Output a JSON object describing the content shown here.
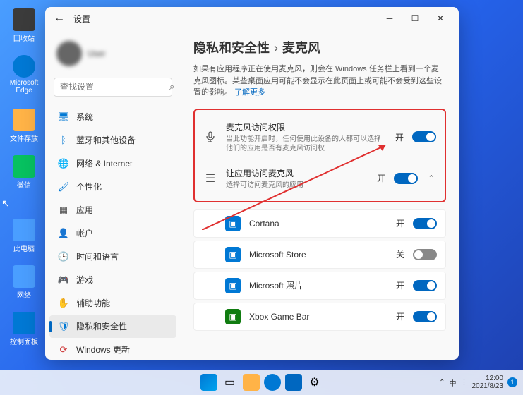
{
  "desktop": {
    "icons": [
      {
        "label": "回收站",
        "color": "#f0f0f0"
      },
      {
        "label": "Microsoft Edge",
        "color": "#0078d4"
      },
      {
        "label": "文件存放",
        "color": "#ffb347"
      },
      {
        "label": "微信",
        "color": "#07c160"
      },
      {
        "label": "此电脑",
        "color": "#4a9eff"
      },
      {
        "label": "网络",
        "color": "#4a9eff"
      },
      {
        "label": "控制面板",
        "color": "#0078d4"
      }
    ]
  },
  "window": {
    "title": "设置",
    "search_placeholder": "查找设置",
    "nav": [
      {
        "icon": "🖥",
        "label": "系统",
        "color": "#0078d4"
      },
      {
        "icon": "ᛒ",
        "label": "蓝牙和其他设备",
        "color": "#0078d4"
      },
      {
        "icon": "🌐",
        "label": "网络 & Internet",
        "color": "#2e7d32"
      },
      {
        "icon": "🖌",
        "label": "个性化",
        "color": "#0078d4"
      },
      {
        "icon": "▦",
        "label": "应用",
        "color": "#555"
      },
      {
        "icon": "👤",
        "label": "帐户",
        "color": "#555"
      },
      {
        "icon": "🕒",
        "label": "时间和语言",
        "color": "#2e7d32"
      },
      {
        "icon": "🎮",
        "label": "游戏",
        "color": "#555"
      },
      {
        "icon": "✋",
        "label": "辅助功能",
        "color": "#0078d4"
      },
      {
        "icon": "🛡",
        "label": "隐私和安全性",
        "color": "#0078d4",
        "selected": true
      },
      {
        "icon": "⟳",
        "label": "Windows 更新",
        "color": "#d04040"
      }
    ]
  },
  "content": {
    "breadcrumb_parent": "隐私和安全性",
    "breadcrumb_current": "麦克风",
    "description": "如果有应用程序正在使用麦克风，则会在 Windows 任务栏上看到一个麦克风图标。某些桌面应用可能不会显示在此页面上或可能不会受到这些设置的影响。",
    "learn_more": "了解更多",
    "mic_access": {
      "title": "麦克风访问权限",
      "sub": "当此功能开启时，任何使用此设备的人都可以选择他们的应用是否有麦克风访问权",
      "state": "开"
    },
    "app_access": {
      "title": "让应用访问麦克风",
      "sub": "选择可访问麦克风的应用",
      "state": "开"
    },
    "apps": [
      {
        "name": "Cortana",
        "state": "开",
        "on": true,
        "color": "#0078d4"
      },
      {
        "name": "Microsoft Store",
        "state": "关",
        "on": false,
        "color": "#0078d4"
      },
      {
        "name": "Microsoft 照片",
        "state": "开",
        "on": true,
        "color": "#0078d4"
      },
      {
        "name": "Xbox Game Bar",
        "state": "开",
        "on": true,
        "color": "#107c10"
      }
    ]
  },
  "tray": {
    "ime": "中",
    "lang_items": "∧",
    "time": "12:00",
    "date": "2021/8/23"
  }
}
